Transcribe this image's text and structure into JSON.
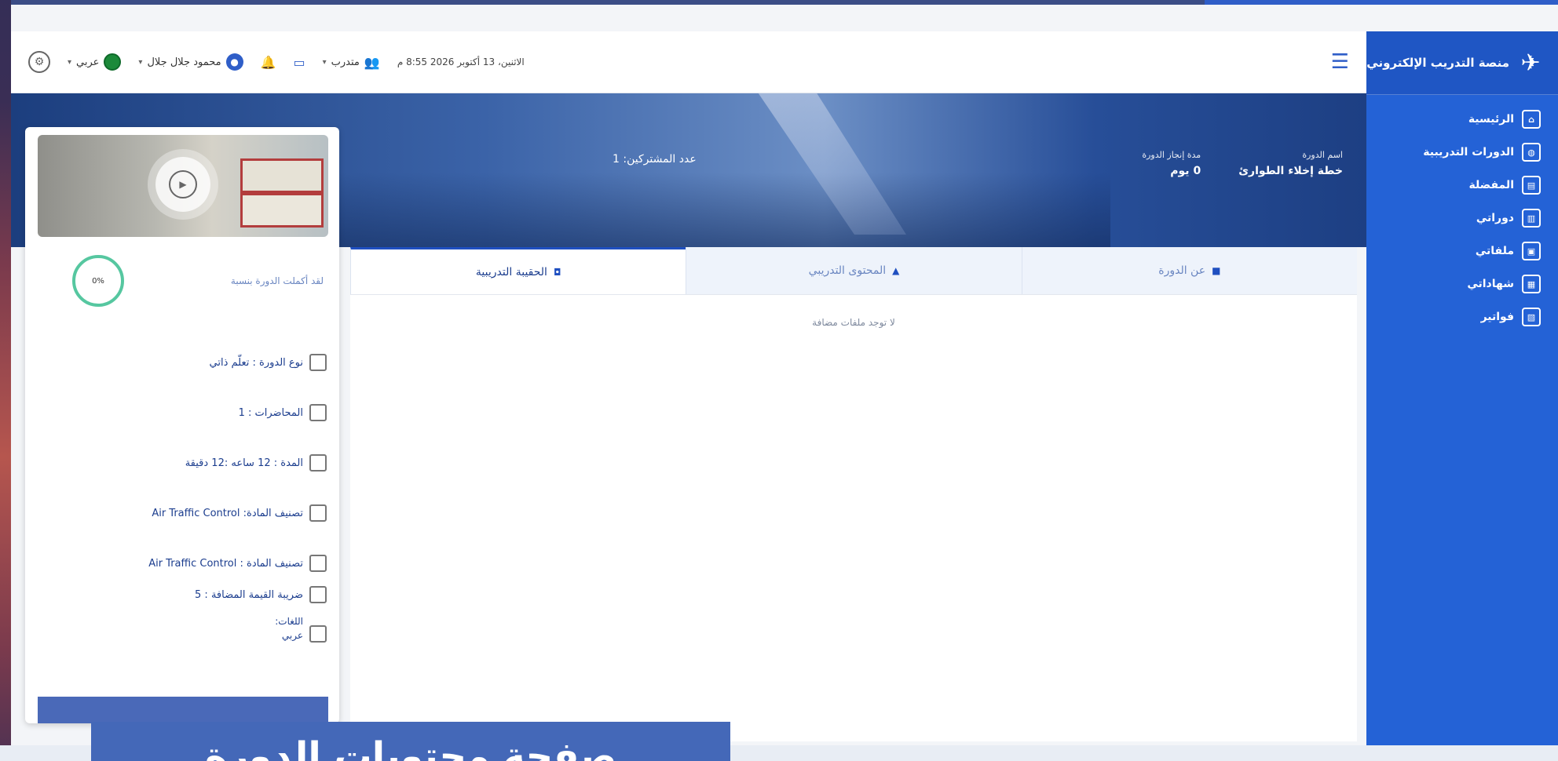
{
  "brand": {
    "title": "منصة التدريب الإلكتروني"
  },
  "sidebar": {
    "items": [
      {
        "label": "الرئيسية",
        "icon": "home-icon",
        "glyph": "⌂"
      },
      {
        "label": "الدورات التدريبية",
        "icon": "globe-icon",
        "glyph": "◍"
      },
      {
        "label": "المفضلة",
        "icon": "bookmark-icon",
        "glyph": "▤"
      },
      {
        "label": "دوراتي",
        "icon": "books-icon",
        "glyph": "▥"
      },
      {
        "label": "ملفاتي",
        "icon": "files-icon",
        "glyph": "▣"
      },
      {
        "label": "شهاداتي",
        "icon": "certificate-icon",
        "glyph": "▦"
      },
      {
        "label": "فواتير",
        "icon": "invoice-icon",
        "glyph": "▧"
      }
    ]
  },
  "header": {
    "date": "الاثنين، 13 أكتوبر 2026 8:55 م",
    "role": "متدرب",
    "user": "محمود جلال جلال",
    "language": "عربي"
  },
  "hero": {
    "course_name_label": "اسم الدورة",
    "course_name": "خطة إخلاء الطوارئ",
    "duration_label": "مدة إنجاز الدورة",
    "duration": "0 يوم",
    "subscribers": "عدد المشتركين: 1"
  },
  "card": {
    "progress_label": "لقد أكملت الدورة بنسبة",
    "progress_percent": "0%",
    "details": [
      "نوع الدورة : تعلّم ذاتي",
      "المحاضرات : 1",
      "المدة : 12 ساعه :12 دقيقة",
      "تصنيف المادة: Air Traffic Control",
      "تصنيف المادة : Air Traffic Control",
      "ضريبة القيمة المضافة : 5"
    ],
    "lang_label": "اللغات:",
    "lang_value": "عربي"
  },
  "tabs": [
    {
      "label": "عن الدورة",
      "glyph": "■"
    },
    {
      "label": "المحتوى التدريبي",
      "glyph": "▲"
    },
    {
      "label": "الحقيبة التدريبية",
      "glyph": "◘"
    }
  ],
  "main": {
    "empty_message": "لا توجد ملفات مضافة"
  },
  "caption": {
    "text": "صفحة محتويات الدورة"
  },
  "colors": {
    "primary": "#2462d6",
    "accent_green": "#56c7a0",
    "caption_bg": "#4468b8"
  }
}
